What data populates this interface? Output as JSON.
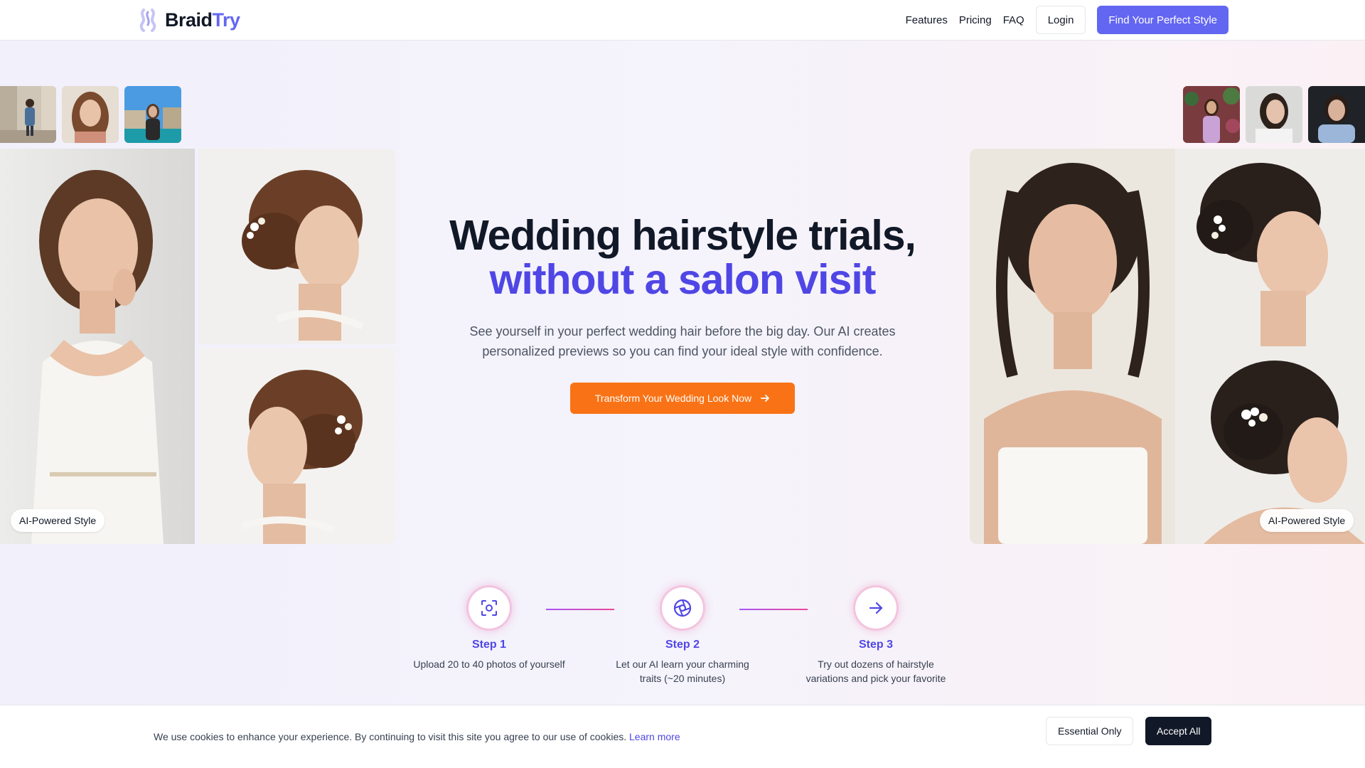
{
  "brand": {
    "name_part1": "Braid",
    "name_part2": "Try"
  },
  "nav": {
    "features": "Features",
    "pricing": "Pricing",
    "faq": "FAQ",
    "login": "Login",
    "cta": "Find Your Perfect Style"
  },
  "hero": {
    "title_line1": "Wedding hairstyle trials,",
    "title_line2": "without a salon visit",
    "subtitle": "See yourself in your perfect wedding hair before the big day. Our AI creates personalized previews so you can find your ideal style with confidence.",
    "cta": "Transform Your Wedding Look Now"
  },
  "badges": {
    "left": "AI-Powered Style",
    "right": "AI-Powered Style"
  },
  "steps": [
    {
      "title": "Step 1",
      "desc": "Upload 20 to 40 photos of yourself",
      "icon": "scan-icon"
    },
    {
      "title": "Step 2",
      "desc": "Let our AI learn your charming traits (~20 minutes)",
      "icon": "aperture-icon"
    },
    {
      "title": "Step 3",
      "desc": "Try out dozens of hairstyle variations and pick your favorite",
      "icon": "arrow-right-icon"
    }
  ],
  "cookie": {
    "text": "We use cookies to enhance your experience. By continuing to visit this site you agree to our use of cookies.",
    "link": "Learn more",
    "essential": "Essential Only",
    "accept": "Accept All"
  },
  "colors": {
    "accent": "#6366f1",
    "accent_dark": "#4f46e5",
    "cta": "#f97316",
    "dark": "#111827"
  }
}
